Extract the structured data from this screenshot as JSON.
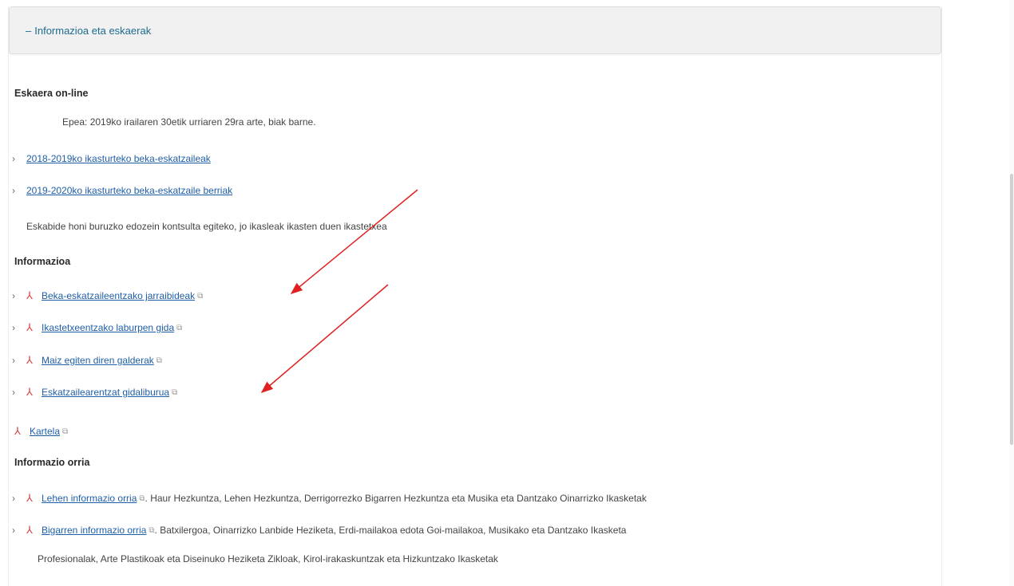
{
  "header": {
    "toggle_symbol": "–",
    "title": "Informazioa eta eskaerak"
  },
  "online": {
    "heading": "Eskaera on-line",
    "deadline": "Epea: 2019ko irailaren 30etik urriaren 29ra arte, biak barne.",
    "links": [
      "2018-2019ko ikasturteko beka-eskatzaileak",
      "2019-2020ko ikasturteko beka-eskatzaile berriak"
    ],
    "note": "Eskabide honi buruzko edozein kontsulta egiteko, jo ikasleak ikasten duen ikastetxea"
  },
  "info": {
    "heading": "Informazioa",
    "links": [
      "Beka-eskatzaileentzako jarraibideak",
      "Ikastetxeentzako laburpen gida",
      "Maiz egiten diren galderak",
      "Eskatzailearentzat gidaliburua"
    ],
    "poster": "Kartela"
  },
  "sheet": {
    "heading": "Informazio orria",
    "items": [
      {
        "link": "Lehen informazio orria",
        "desc": ". Haur Hezkuntza, Lehen Hezkuntza, Derrigorrezko Bigarren Hezkuntza eta Musika eta Dantzako Oinarrizko Ikasketak"
      },
      {
        "link": "Bigarren informazio orria",
        "desc": ". Batxilergoa, Oinarrizko Lanbide Heziketa, Erdi-mailakoa edota Goi-mailakoa, Musikako eta Dantzako Ikasketa",
        "desc2": "Profesionalak, Arte Plastikoak eta Diseinuko Heziketa Zikloak, Kirol-irakaskuntzak eta Hizkuntzako Ikasketak"
      }
    ]
  },
  "icons": {
    "chevron": "chevron-right-icon",
    "pdf": "pdf-icon",
    "external": "external-window-icon"
  },
  "colors": {
    "link": "#1f5fa8",
    "header_text": "#1d6a8e",
    "annotation_arrow": "#e02020",
    "pdf_icon": "#d64545"
  }
}
